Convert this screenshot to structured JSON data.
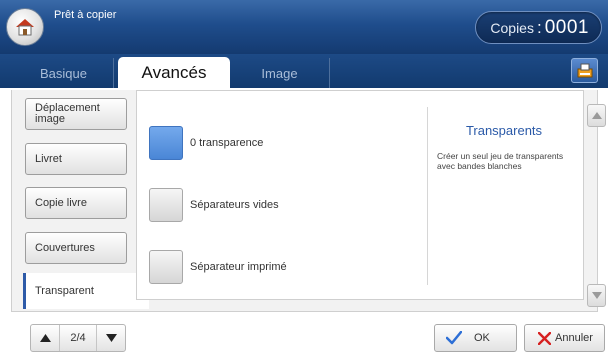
{
  "header": {
    "title": "Prêt à copier",
    "copies_label": "Copies",
    "copies_colon": ":",
    "copies_value": "0001"
  },
  "tabs": [
    {
      "label": "Basique"
    },
    {
      "label": "Avancés"
    },
    {
      "label": "Image"
    }
  ],
  "sidebar": {
    "items": [
      {
        "label": "Déplacement image"
      },
      {
        "label": "Livret"
      },
      {
        "label": "Copie livre"
      },
      {
        "label": "Couvertures"
      },
      {
        "label": "Transparent"
      }
    ]
  },
  "options": [
    {
      "label": "0 transparence",
      "selected": true
    },
    {
      "label": "Séparateurs vides",
      "selected": false
    },
    {
      "label": "Séparateur imprimé",
      "selected": false
    }
  ],
  "description": {
    "title": "Transparents",
    "text": "Créer un seul jeu de transparents avec bandes blanches"
  },
  "pager": {
    "text": "2/4"
  },
  "buttons": {
    "ok": "OK",
    "cancel": "Annuler"
  },
  "colors": {
    "header_blue": "#1f4d8c",
    "accent_blue": "#2b5aa8",
    "selected_option": "#4a86d6",
    "ok_check": "#2d6fd6",
    "cancel_x": "#d62020"
  },
  "icons": {
    "home": "home-icon",
    "copy_settings": "copy-settings-icon",
    "scroll_up": "triangle-up-icon",
    "scroll_down": "triangle-down-icon",
    "page_prev": "triangle-up-icon",
    "page_next": "triangle-down-icon",
    "ok": "checkmark-icon",
    "cancel": "x-icon"
  }
}
